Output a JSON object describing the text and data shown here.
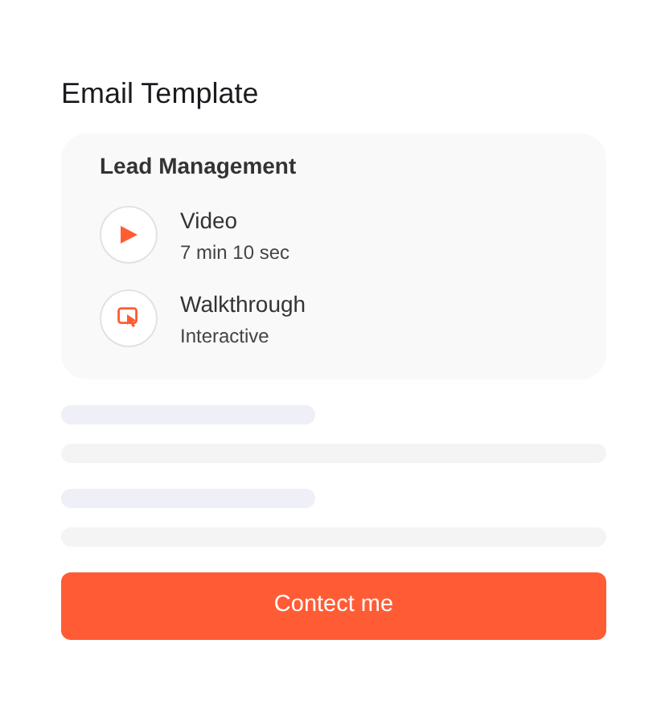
{
  "title": "Email Template",
  "card": {
    "heading": "Lead Management",
    "items": [
      {
        "kind": "video",
        "title": "Video",
        "subtitle": "7 min 10 sec"
      },
      {
        "kind": "walkthrough",
        "title": "Walkthrough",
        "subtitle": "Interactive"
      }
    ]
  },
  "button": "Contect me"
}
